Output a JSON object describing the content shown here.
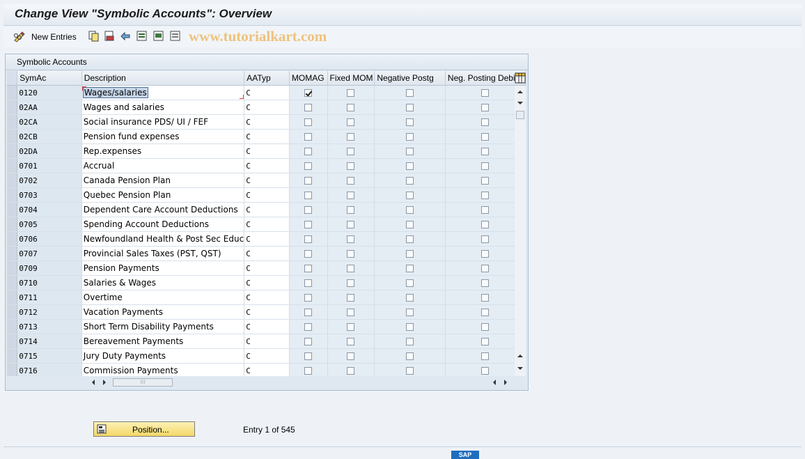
{
  "window": {
    "title": "Change View \"Symbolic Accounts\": Overview"
  },
  "toolbar": {
    "new_entries_label": "New Entries"
  },
  "watermark": "www.tutorialkart.com",
  "panel": {
    "title": "Symbolic Accounts"
  },
  "table": {
    "columns": [
      "SymAc",
      "Description",
      "AATyp",
      "MOMAG",
      "Fixed MOM",
      "Negative Postg",
      "Neg. Posting Debit"
    ],
    "rows": [
      {
        "symac": "0120",
        "description": "Wages/salaries",
        "aatyp": "C",
        "momag": true,
        "fixed_mom": false,
        "negative_postg": false,
        "neg_posting_debit": false
      },
      {
        "symac": "02AA",
        "description": "Wages and salaries",
        "aatyp": "C",
        "momag": false,
        "fixed_mom": false,
        "negative_postg": false,
        "neg_posting_debit": false
      },
      {
        "symac": "02CA",
        "description": "Social insurance PDS/ UI / FEF",
        "aatyp": "C",
        "momag": false,
        "fixed_mom": false,
        "negative_postg": false,
        "neg_posting_debit": false
      },
      {
        "symac": "02CB",
        "description": "Pension fund expenses",
        "aatyp": "C",
        "momag": false,
        "fixed_mom": false,
        "negative_postg": false,
        "neg_posting_debit": false
      },
      {
        "symac": "02DA",
        "description": "Rep.expenses",
        "aatyp": "C",
        "momag": false,
        "fixed_mom": false,
        "negative_postg": false,
        "neg_posting_debit": false
      },
      {
        "symac": "0701",
        "description": "Accrual",
        "aatyp": "C",
        "momag": false,
        "fixed_mom": false,
        "negative_postg": false,
        "neg_posting_debit": false
      },
      {
        "symac": "0702",
        "description": "Canada Pension Plan",
        "aatyp": "C",
        "momag": false,
        "fixed_mom": false,
        "negative_postg": false,
        "neg_posting_debit": false
      },
      {
        "symac": "0703",
        "description": "Quebec Pension Plan",
        "aatyp": "C",
        "momag": false,
        "fixed_mom": false,
        "negative_postg": false,
        "neg_posting_debit": false
      },
      {
        "symac": "0704",
        "description": "Dependent Care Account Deductions",
        "aatyp": "C",
        "momag": false,
        "fixed_mom": false,
        "negative_postg": false,
        "neg_posting_debit": false
      },
      {
        "symac": "0705",
        "description": "Spending Account Deductions",
        "aatyp": "C",
        "momag": false,
        "fixed_mom": false,
        "negative_postg": false,
        "neg_posting_debit": false
      },
      {
        "symac": "0706",
        "description": "Newfoundland Health & Post Sec Educ",
        "aatyp": "C",
        "momag": false,
        "fixed_mom": false,
        "negative_postg": false,
        "neg_posting_debit": false
      },
      {
        "symac": "0707",
        "description": "Provincial Sales Taxes (PST, QST)",
        "aatyp": "C",
        "momag": false,
        "fixed_mom": false,
        "negative_postg": false,
        "neg_posting_debit": false
      },
      {
        "symac": "0709",
        "description": "Pension Payments",
        "aatyp": "C",
        "momag": false,
        "fixed_mom": false,
        "negative_postg": false,
        "neg_posting_debit": false
      },
      {
        "symac": "0710",
        "description": "Salaries & Wages",
        "aatyp": "C",
        "momag": false,
        "fixed_mom": false,
        "negative_postg": false,
        "neg_posting_debit": false
      },
      {
        "symac": "0711",
        "description": "Overtime",
        "aatyp": "C",
        "momag": false,
        "fixed_mom": false,
        "negative_postg": false,
        "neg_posting_debit": false
      },
      {
        "symac": "0712",
        "description": "Vacation Payments",
        "aatyp": "C",
        "momag": false,
        "fixed_mom": false,
        "negative_postg": false,
        "neg_posting_debit": false
      },
      {
        "symac": "0713",
        "description": "Short Term Disability Payments",
        "aatyp": "C",
        "momag": false,
        "fixed_mom": false,
        "negative_postg": false,
        "neg_posting_debit": false
      },
      {
        "symac": "0714",
        "description": "Bereavement Payments",
        "aatyp": "C",
        "momag": false,
        "fixed_mom": false,
        "negative_postg": false,
        "neg_posting_debit": false
      },
      {
        "symac": "0715",
        "description": "Jury Duty Payments",
        "aatyp": "C",
        "momag": false,
        "fixed_mom": false,
        "negative_postg": false,
        "neg_posting_debit": false
      },
      {
        "symac": "0716",
        "description": "Commission Payments",
        "aatyp": "C",
        "momag": false,
        "fixed_mom": false,
        "negative_postg": false,
        "neg_posting_debit": false
      }
    ]
  },
  "footer": {
    "position_label": "Position...",
    "entry_info": "Entry 1 of 545"
  },
  "status": {
    "logo": "SAP"
  },
  "icons": {
    "toolbar": [
      "pencil-glasses-icon",
      "copy-icon",
      "delete-icon",
      "undo-icon",
      "select-all-icon",
      "select-block-icon",
      "deselect-all-icon"
    ],
    "position": "position-icon",
    "column_config": "table-settings-icon"
  },
  "colors": {
    "accent_button": "#f3d768",
    "header_bg": "#dfe6ee",
    "key_column_bg": "#dde7f0",
    "checkbox_column_bg": "#e4ecf4"
  }
}
